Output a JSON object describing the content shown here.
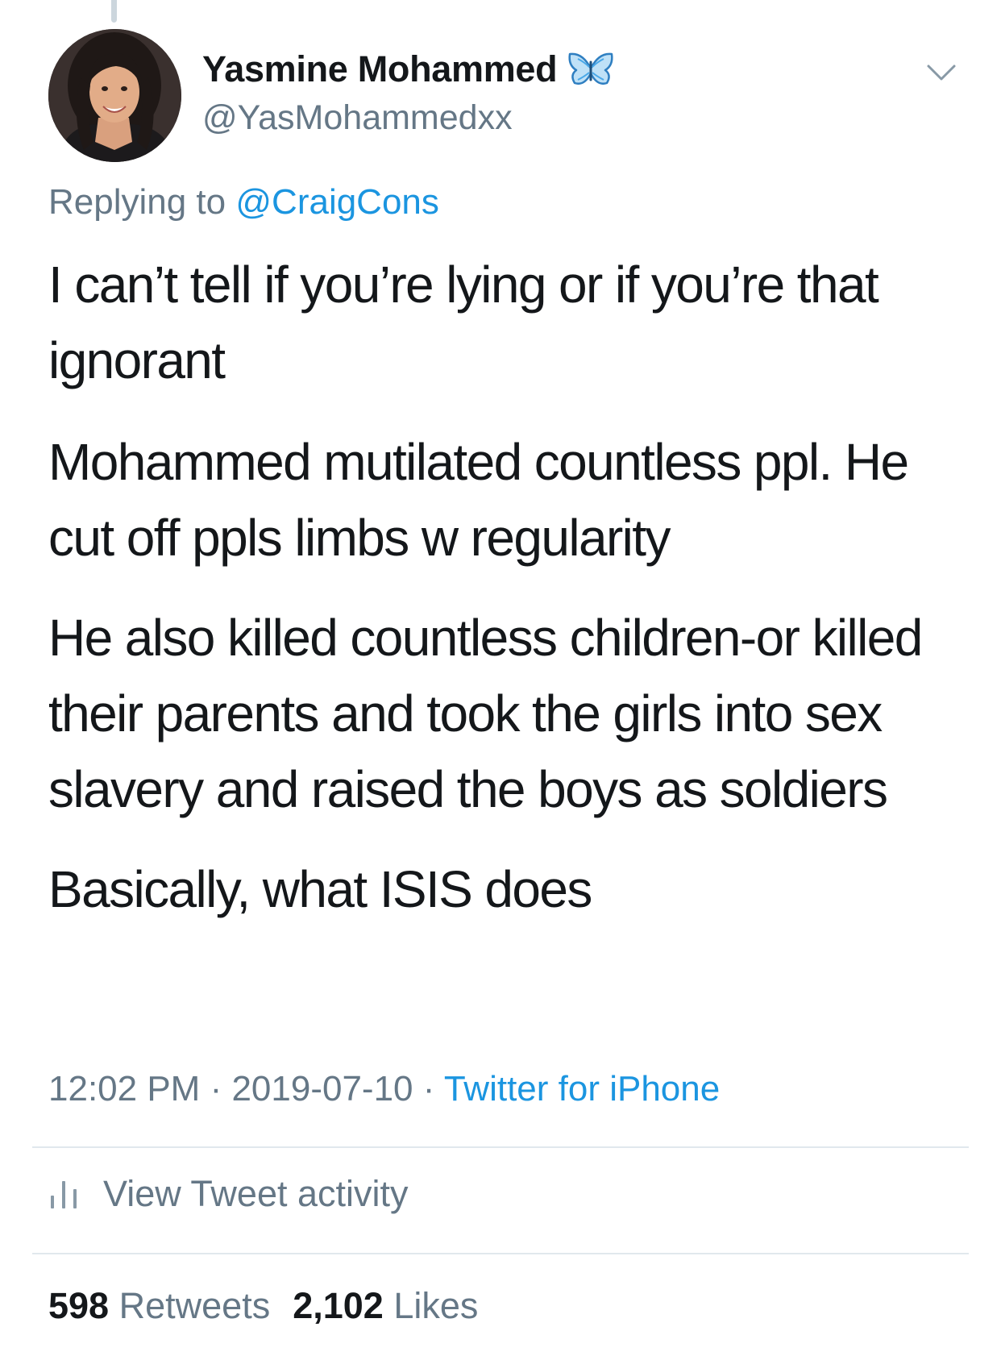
{
  "author": {
    "display_name": "Yasmine Mohammed",
    "handle": "@YasMohammedxx",
    "badge_icon": "butterfly-icon",
    "avatar": "avatar-photo"
  },
  "reply": {
    "prefix": "Replying to",
    "mention": "@CraigCons"
  },
  "tweet": {
    "paragraphs": [
      "I can’t tell if you’re lying or if you’re that ignorant",
      "Mohammed mutilated countless ppl. He cut off ppls limbs w regularity",
      "He also killed countless children-or killed their parents and took the girls into sex slavery and raised the boys as soldiers",
      "Basically, what ISIS does"
    ]
  },
  "meta": {
    "time": "12:02 PM",
    "separator": " · ",
    "date": "2019-07-10",
    "source": "Twitter for iPhone"
  },
  "activity": {
    "icon": "bar-chart-icon",
    "label": "View Tweet activity"
  },
  "stats": {
    "retweets_count": "598",
    "retweets_label": "Retweets",
    "likes_count": "2,102",
    "likes_label": "Likes"
  },
  "colors": {
    "text": "#14171a",
    "secondary": "#657786",
    "link": "#1b95e0",
    "divider": "#e1e8ed",
    "butterfly": "#4aa8e8"
  }
}
